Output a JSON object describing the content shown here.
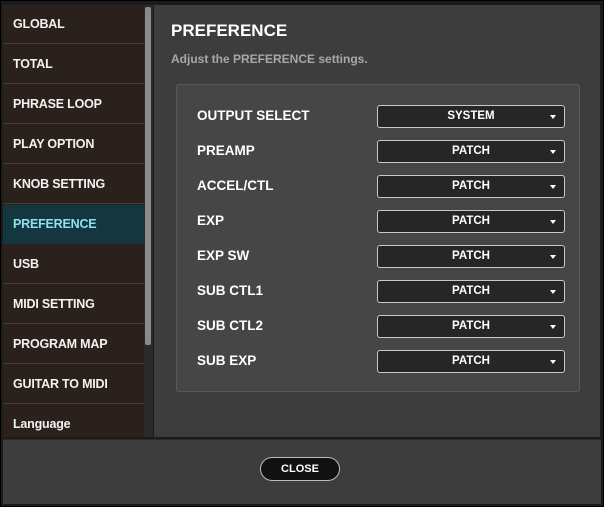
{
  "sidebar": {
    "items": [
      {
        "label": "GLOBAL"
      },
      {
        "label": "TOTAL"
      },
      {
        "label": "PHRASE LOOP"
      },
      {
        "label": "PLAY OPTION"
      },
      {
        "label": "KNOB SETTING"
      },
      {
        "label": "PREFERENCE",
        "active": true
      },
      {
        "label": "USB"
      },
      {
        "label": "MIDI SETTING"
      },
      {
        "label": "PROGRAM MAP"
      },
      {
        "label": "GUITAR TO MIDI"
      },
      {
        "label": "Language"
      }
    ]
  },
  "main": {
    "title": "PREFERENCE",
    "subtitle": "Adjust the PREFERENCE settings.",
    "settings": [
      {
        "label": "OUTPUT SELECT",
        "value": "SYSTEM"
      },
      {
        "label": "PREAMP",
        "value": "PATCH"
      },
      {
        "label": "ACCEL/CTL",
        "value": "PATCH"
      },
      {
        "label": "EXP",
        "value": "PATCH"
      },
      {
        "label": "EXP SW",
        "value": "PATCH"
      },
      {
        "label": "SUB CTL1",
        "value": "PATCH"
      },
      {
        "label": "SUB CTL2",
        "value": "PATCH"
      },
      {
        "label": "SUB EXP",
        "value": "PATCH"
      }
    ]
  },
  "footer": {
    "close_label": "CLOSE"
  },
  "colors": {
    "active_item_bg": "#14373f",
    "active_item_text": "#8ee0ee",
    "sidebar_bg": "#2b211c",
    "content_bg": "#3d3d3d"
  }
}
